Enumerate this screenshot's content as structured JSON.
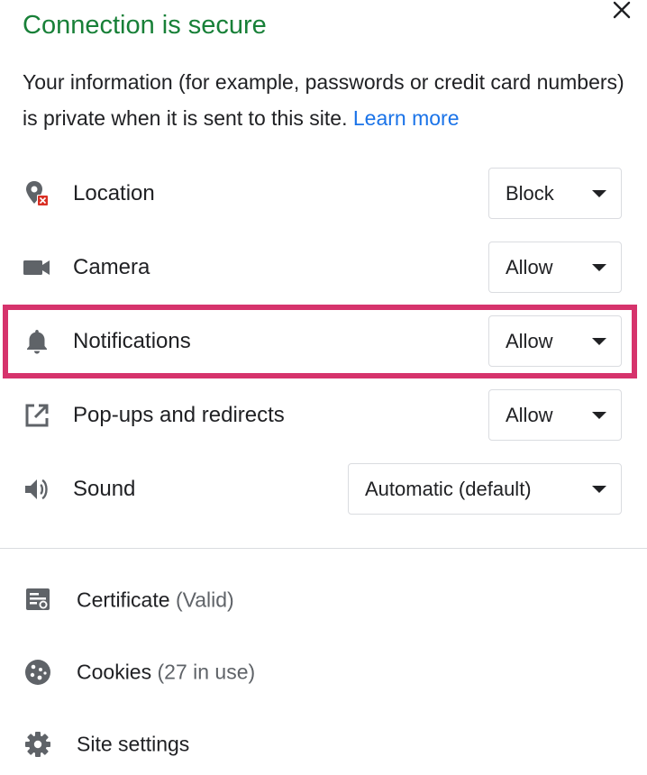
{
  "header": {
    "title": "Connection is secure",
    "close_icon": "close-icon"
  },
  "description": {
    "text": "Your information (for example, passwords or credit card numbers) is private when it is sent to this site.",
    "link": "Learn more"
  },
  "permissions": [
    {
      "label": "Location",
      "value": "Block",
      "icon": "location-blocked-icon"
    },
    {
      "label": "Camera",
      "value": "Allow",
      "icon": "camera-icon"
    },
    {
      "label": "Notifications",
      "value": "Allow",
      "icon": "bell-icon",
      "highlighted": true
    },
    {
      "label": "Pop-ups and redirects",
      "value": "Allow",
      "icon": "external-link-icon"
    },
    {
      "label": "Sound",
      "value": "Automatic (default)",
      "icon": "speaker-icon"
    }
  ],
  "info_items": [
    {
      "label": "Certificate",
      "sub": "(Valid)",
      "icon": "certificate-icon"
    },
    {
      "label": "Cookies",
      "sub": "(27 in use)",
      "icon": "cookie-icon"
    },
    {
      "label": "Site settings",
      "sub": "",
      "icon": "gear-icon"
    }
  ],
  "colors": {
    "title_green": "#188038",
    "link_blue": "#1a73e8",
    "highlight_pink": "#d6336c",
    "blocked_red": "#d93025"
  }
}
